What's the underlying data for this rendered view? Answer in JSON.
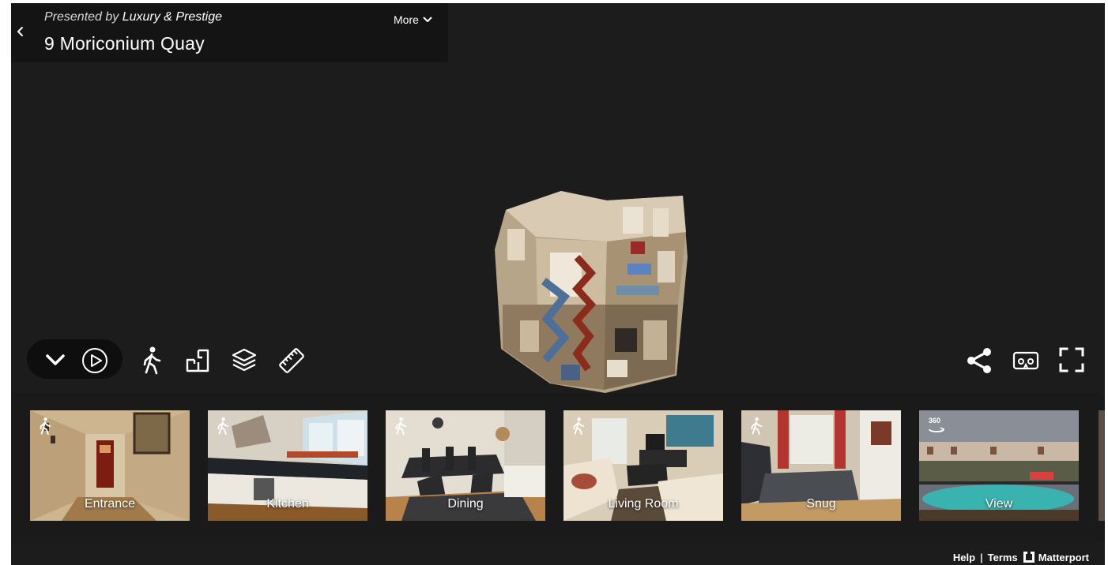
{
  "header": {
    "presented_prefix": "Presented by",
    "presenter": "Luxury & Prestige",
    "title": "9 Moriconium Quay",
    "more_label": "More"
  },
  "toolbar": {
    "left_icons": [
      "chevron-down-icon",
      "play-icon",
      "walk-icon",
      "floorplan-icon",
      "layers-icon",
      "ruler-icon"
    ],
    "right_icons": [
      "share-icon",
      "vr-icon",
      "fullscreen-icon"
    ]
  },
  "highlights": [
    {
      "label": "Entrance",
      "icon": "walk-icon"
    },
    {
      "label": "Kitchen",
      "icon": "walk-icon"
    },
    {
      "label": "Dining",
      "icon": "walk-icon"
    },
    {
      "label": "Living Room",
      "icon": "walk-icon"
    },
    {
      "label": "Snug",
      "icon": "walk-icon"
    },
    {
      "label": "View",
      "icon": "360-icon"
    }
  ],
  "footer": {
    "help": "Help",
    "separator": "|",
    "terms": "Terms",
    "brand": "Matterport"
  },
  "badges": {
    "pano_360": "360"
  },
  "colors": {
    "background": "#1c1c1d",
    "header_bg": "#141415",
    "text": "#ffffff"
  }
}
